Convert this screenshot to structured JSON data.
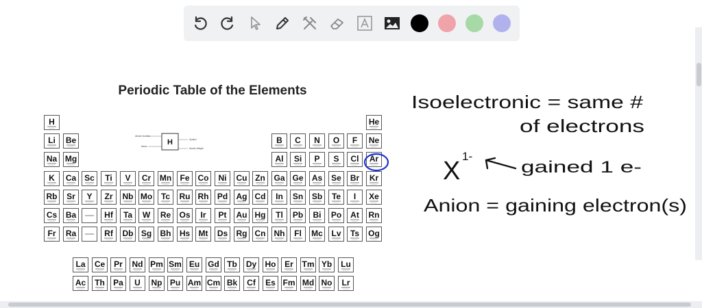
{
  "toolbar": {
    "tools": [
      "undo-icon",
      "redo-icon",
      "pointer-icon",
      "pen-icon",
      "tools-icon",
      "eraser-icon",
      "text-icon",
      "image-icon"
    ],
    "colors": [
      "#000000",
      "#f0a3a9",
      "#a6d9a6",
      "#b1b1ee"
    ]
  },
  "periodic_table": {
    "title": "Periodic Table of the Elements",
    "legend": {
      "symbol": "H",
      "labels": [
        "Atomic Number",
        "Symbol",
        "Name",
        "Atomic Weight"
      ]
    },
    "main": [
      [
        "H",
        "",
        "",
        "",
        "",
        "",
        "",
        "",
        "",
        "",
        "",
        "",
        "",
        "",
        "",
        "",
        "",
        "He"
      ],
      [
        "Li",
        "Be",
        "",
        "",
        "",
        "",
        "",
        "",
        "",
        "",
        "",
        "",
        "B",
        "C",
        "N",
        "O",
        "F",
        "Ne"
      ],
      [
        "Na",
        "Mg",
        "",
        "",
        "",
        "",
        "",
        "",
        "",
        "",
        "",
        "",
        "Al",
        "Si",
        "P",
        "S",
        "Cl",
        "Ar"
      ],
      [
        "K",
        "Ca",
        "Sc",
        "Ti",
        "V",
        "Cr",
        "Mn",
        "Fe",
        "Co",
        "Ni",
        "Cu",
        "Zn",
        "Ga",
        "Ge",
        "As",
        "Se",
        "Br",
        "Kr"
      ],
      [
        "Rb",
        "Sr",
        "Y",
        "Zr",
        "Nb",
        "Mo",
        "Tc",
        "Ru",
        "Rh",
        "Pd",
        "Ag",
        "Cd",
        "In",
        "Sn",
        "Sb",
        "Te",
        "I",
        "Xe"
      ],
      [
        "Cs",
        "Ba",
        "",
        "Hf",
        "Ta",
        "W",
        "Re",
        "Os",
        "Ir",
        "Pt",
        "Au",
        "Hg",
        "Tl",
        "Pb",
        "Bi",
        "Po",
        "At",
        "Rn"
      ],
      [
        "Fr",
        "Ra",
        "",
        "Rf",
        "Db",
        "Sg",
        "Bh",
        "Hs",
        "Mt",
        "Ds",
        "Rg",
        "Cn",
        "Nh",
        "Fl",
        "Mc",
        "Lv",
        "Ts",
        "Og"
      ]
    ],
    "f_block": [
      [
        "La",
        "Ce",
        "Pr",
        "Nd",
        "Pm",
        "Sm",
        "Eu",
        "Gd",
        "Tb",
        "Dy",
        "Ho",
        "Er",
        "Tm",
        "Yb",
        "Lu"
      ],
      [
        "Ac",
        "Th",
        "Pa",
        "U",
        "Np",
        "Pu",
        "Am",
        "Cm",
        "Bk",
        "Cf",
        "Es",
        "Fm",
        "Md",
        "No",
        "Lr"
      ]
    ],
    "circled": "Ar",
    "annotation_color": "#1c2fd6"
  },
  "handwriting": {
    "line1": "Isoelectronic = same #",
    "line2": "of electrons",
    "ion_symbol": "X",
    "ion_charge": "1-",
    "note": "gained 1 e-",
    "line4": "Anion = gaining electron(s)"
  }
}
